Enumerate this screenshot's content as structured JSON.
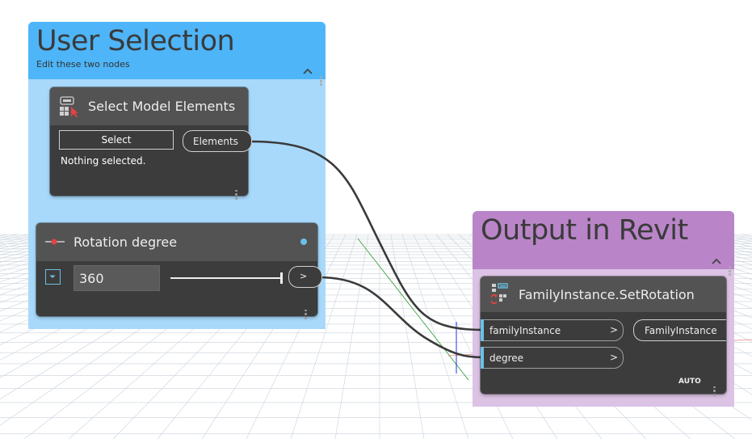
{
  "groups": {
    "user_selection": {
      "title": "User Selection",
      "description": "Edit these two  nodes",
      "color": "#4eb5f8",
      "body_color": "#a8d9fb"
    },
    "output": {
      "title": "Output in Revit",
      "description": "",
      "color": "#b985c8",
      "body_color": "#dcc3e5"
    }
  },
  "nodes": {
    "select_elements": {
      "title": "Select Model Elements",
      "icon": "select-model-elements-icon",
      "button_label": "Select",
      "status_text": "Nothing selected.",
      "output_port": "Elements"
    },
    "rotation": {
      "title": "Rotation degree",
      "icon": "slider-icon",
      "value": "360",
      "slider_fraction": 1.0,
      "output_port": ">",
      "expand_icon": "chevron-down-icon",
      "status_color": "#6ac0e7"
    },
    "set_rotation": {
      "title": "FamilyInstance.SetRotation",
      "icon": "family-instance-icon",
      "inputs": [
        {
          "name": "familyInstance",
          "arrow": ">"
        },
        {
          "name": "degree",
          "arrow": ">"
        }
      ],
      "output_port": "FamilyInstance",
      "lacing": "AUTO"
    }
  },
  "colors": {
    "node_body": "#3c3c3c",
    "node_header": "#535353",
    "wire": "#3a3a3a",
    "port_marker": "#6ac0e7"
  }
}
